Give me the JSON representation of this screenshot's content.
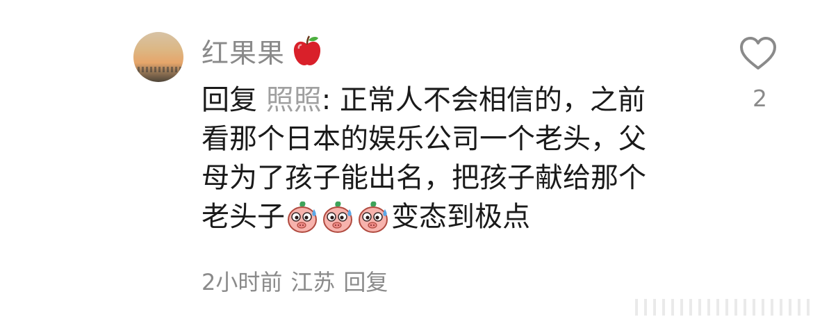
{
  "comment": {
    "username": "红果果",
    "username_emoji_icon": "red-apple-icon",
    "reply_prefix": "回复",
    "mention": "照照",
    "separator": ":",
    "text_line1": " 正常人不会相信的，之前",
    "text_line2": "看那个日本的娱乐公司一个老头，父",
    "text_line3": "母为了孩子能出名，把孩子献给那个",
    "text_line4_start": "老头子",
    "inline_emoji_icon": "sweating-pig-emoji-icon",
    "inline_emoji_count": 3,
    "text_line4_end": "变态到极点",
    "time": "2小时前",
    "location": "江苏",
    "reply_action": "回复"
  },
  "like": {
    "icon": "heart-outline-icon",
    "count": "2"
  },
  "colors": {
    "primary_text": "#1a1a1a",
    "secondary_text": "#8a8a8a",
    "mention": "#a0a0a0",
    "background": "#ffffff"
  }
}
